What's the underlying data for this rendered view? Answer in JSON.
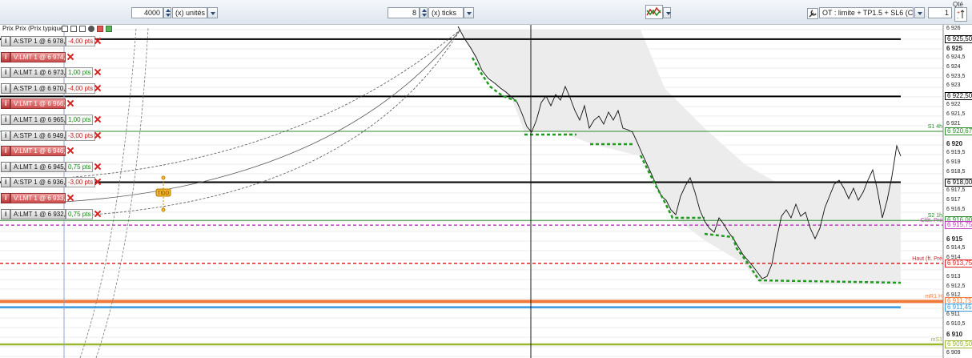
{
  "toolbar": {
    "units_value": "4000",
    "units_label": "(x) unités",
    "ticks_value": "8",
    "ticks_label": "(x) ticks",
    "order_template": "OT : limite + TP1.5 + SL6 (C1.5,S6)",
    "qty_label": "Qté",
    "qty_value": "1"
  },
  "chart_header": {
    "title": "Prix Prix (Prix typique)"
  },
  "orders": [
    {
      "label": "A:STP 1 @ 6 978,50",
      "pts": "-4,00 pts",
      "tab": "gray",
      "pts_color": "#c62020"
    },
    {
      "label": "V:LMT 1 @ 6 974,50",
      "pts": "",
      "tab": "red",
      "pts_color": "#c62020"
    },
    {
      "label": "A:LMT 1 @ 6 973,50",
      "pts": "1,00 pts",
      "tab": "gray",
      "pts_color": "#1f8a1f"
    },
    {
      "label": "A:STP 1 @ 6 970,25",
      "pts": "-4,00 pts",
      "tab": "gray",
      "pts_color": "#c62020"
    },
    {
      "label": "V:LMT 1 @ 6 966,25",
      "pts": "",
      "tab": "red",
      "pts_color": "#c62020"
    },
    {
      "label": "A:LMT 1 @ 6 965,25",
      "pts": "1,00 pts",
      "tab": "gray",
      "pts_color": "#1f8a1f"
    },
    {
      "label": "A:STP 1 @ 6 949,00",
      "pts": "-3,00 pts",
      "tab": "gray",
      "pts_color": "#c62020"
    },
    {
      "label": "V:LMT 1 @ 6 946,00",
      "pts": "",
      "tab": "red",
      "pts_color": "#c62020"
    },
    {
      "label": "A:LMT 1 @ 6 945,25",
      "pts": "0,75 pts",
      "tab": "gray",
      "pts_color": "#1f8a1f"
    },
    {
      "label": "A:STP 1 @ 6 936,00",
      "pts": "-3,00 pts",
      "tab": "gray",
      "pts_color": "#c62020"
    },
    {
      "label": "V:LMT 1 @ 6 933,00",
      "pts": "",
      "tab": "red",
      "pts_color": "#c62020"
    },
    {
      "label": "A:LMT 1 @ 6 932,25",
      "pts": "0,75 pts",
      "tab": "gray",
      "pts_color": "#1f8a1f"
    }
  ],
  "axis": {
    "ticks": [
      "6 926",
      "6 925,50",
      "6 925",
      "6 924,5",
      "6 924",
      "6 923,5",
      "6 923",
      "6 922,50",
      "6 922",
      "6 921,5",
      "6 921",
      "6 920,67",
      "6 920",
      "6 919,5",
      "6 919",
      "6 918,5",
      "6 918,00",
      "6 917,5",
      "6 917",
      "6 916,5",
      "6 916,00",
      "6 915,75",
      "6 915",
      "6 914,5",
      "6 914",
      "6 913,75",
      "6 913",
      "6 912,5",
      "6 912",
      "6 911,75",
      "6 911,45",
      "6 911",
      "6 910,5",
      "6 910",
      "6 909,50",
      "6 909,5",
      "6 909"
    ]
  },
  "price_tags": [
    {
      "text": "6 925,50",
      "color": "#000000"
    },
    {
      "text": "6 922,50",
      "color": "#000000"
    },
    {
      "text": "6 920,67",
      "color": "#2e8b2e"
    },
    {
      "text": "6 918,00",
      "color": "#000000"
    },
    {
      "text": "6 916,00",
      "color": "#2e8b2e"
    },
    {
      "text": "6 915,75",
      "color": "#c040c0"
    },
    {
      "text": "6 913,75",
      "color": "#e02020"
    },
    {
      "text": "6 911,75",
      "color": "#f07a3a"
    },
    {
      "text": "6 911,45",
      "color": "#3a9be0"
    },
    {
      "text": "6 909,50",
      "color": "#9ab82e"
    }
  ],
  "line_labels": [
    {
      "text": "S1 4h",
      "color": "#2e8b2e"
    },
    {
      "text": "S2 1h",
      "color": "#2e8b2e"
    },
    {
      "text": "Clôt. Pré",
      "color": "#c040c0"
    },
    {
      "text": "Haut (ft. Pré",
      "color": "#e02020"
    },
    {
      "text": "mR1 H",
      "color": "#f07a3a"
    },
    {
      "text": "mS1",
      "color": "#9ab82e"
    }
  ],
  "annotation": {
    "marker_text": "TIDO"
  },
  "colors": {
    "accent": "#2c4d74",
    "up_line": "#2e8b2e",
    "magenta": "#c040c0",
    "red": "#e02020",
    "orange": "#f07a3a",
    "blue": "#3a9be0",
    "olive": "#9ab82e",
    "dot_green": "#1f9a1f"
  }
}
